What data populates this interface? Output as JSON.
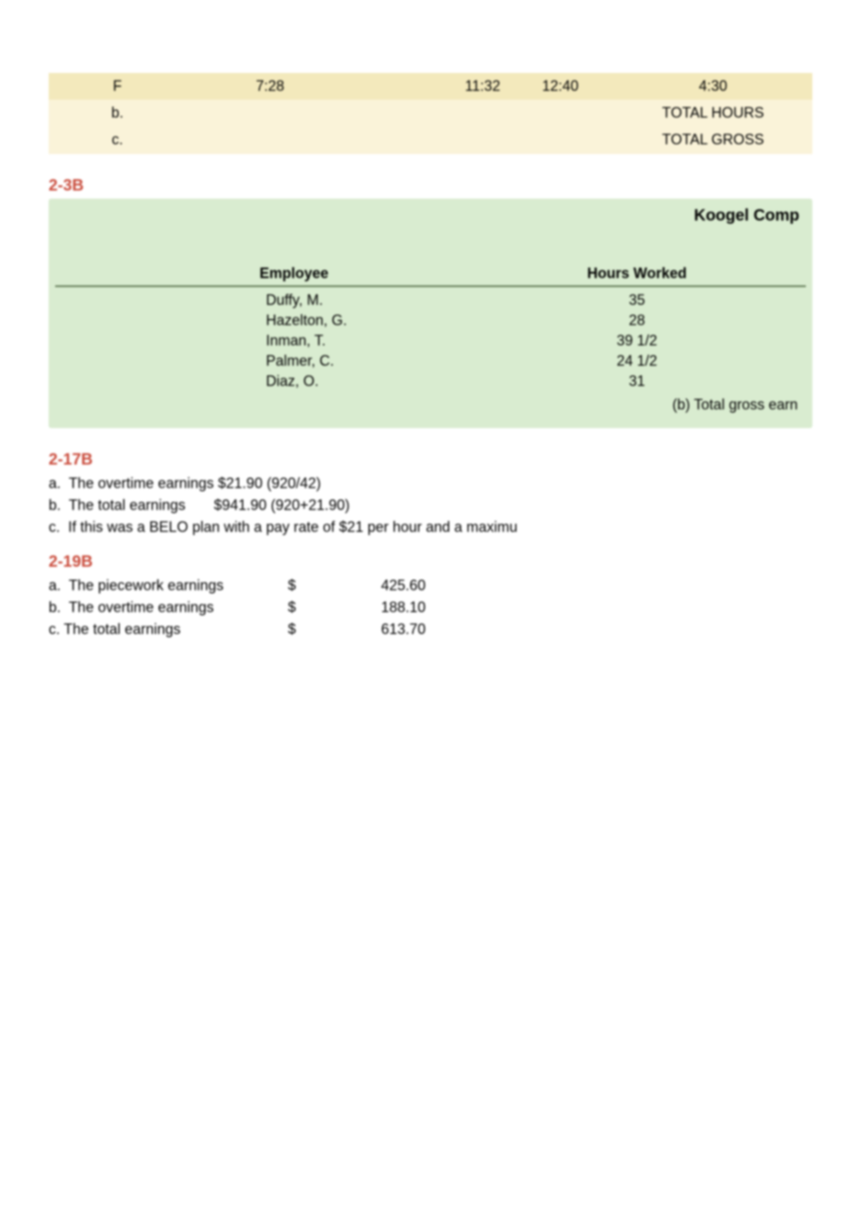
{
  "top_table": {
    "row_f": {
      "day": "F",
      "t1": "7:28",
      "t2": "11:32",
      "t3": "12:40",
      "t4": "4:30"
    },
    "row_b": {
      "label": "b.",
      "total": "TOTAL HOURS"
    },
    "row_c": {
      "label": "c.",
      "total": "TOTAL GROSS"
    }
  },
  "section_2_3b": {
    "heading": "2-3B",
    "company": "Koogel Comp",
    "headers": {
      "employee": "Employee",
      "hours": "Hours Worked"
    },
    "rows": [
      {
        "name": "Duffy, M.",
        "hours": "35"
      },
      {
        "name": "Hazelton, G.",
        "hours": "28"
      },
      {
        "name": "Inman, T.",
        "hours": "39 1/2"
      },
      {
        "name": "Palmer, C.",
        "hours": "24 1/2"
      },
      {
        "name": "Diaz, O.",
        "hours": "31"
      }
    ],
    "footer": "(b) Total gross earn"
  },
  "section_2_17b": {
    "heading": "2-17B",
    "lines": [
      "a.  The overtime earnings $21.90 (920/42)",
      "b.  The total earnings       $941.90 (920+21.90)",
      "c.  If this was a BELO plan with a pay rate of $21 per hour and a maximu"
    ]
  },
  "section_2_19b": {
    "heading": "2-19B",
    "rows": [
      {
        "label": "a.  The piecework earnings",
        "symbol": "$",
        "value": "425.60"
      },
      {
        "label": "b.  The overtime earnings",
        "symbol": "$",
        "value": "188.10"
      },
      {
        "label": "c. The total earnings",
        "symbol": "$",
        "value": "613.70"
      }
    ]
  }
}
